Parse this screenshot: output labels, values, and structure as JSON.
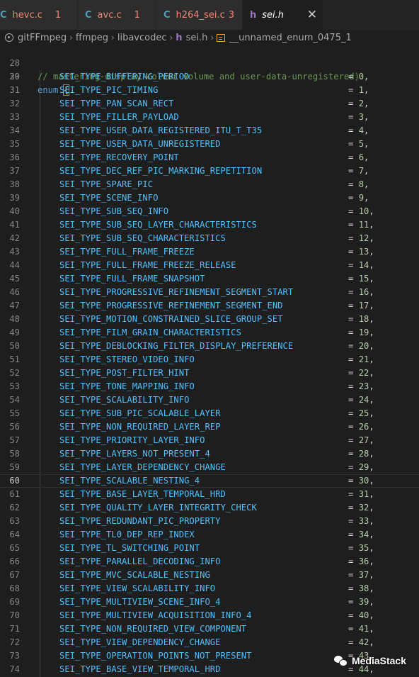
{
  "tabs": [
    {
      "icon": "C",
      "icon_color": "#519aba",
      "name": "hevc.c",
      "name_color": "#f48771",
      "badge": "1",
      "badge_color": "#f48771",
      "active": false
    },
    {
      "icon": "C",
      "icon_color": "#519aba",
      "name": "avc.c",
      "name_color": "#f48771",
      "badge": "1",
      "badge_color": "#f48771",
      "active": false
    },
    {
      "icon": "C",
      "icon_color": "#519aba",
      "name": "h264_sei.c",
      "name_color": "#f48771",
      "badge": "3",
      "badge_color": "#f48771",
      "active": false
    },
    {
      "icon": "h",
      "icon_color": "#a074c4",
      "name": "sei.h",
      "name_color": "#ffffff",
      "badge": "",
      "badge_color": "",
      "active": true,
      "close": "✕"
    }
  ],
  "breadcrumb": {
    "items": [
      "gitFFmpeg",
      "ffmpeg",
      "libavcodec",
      "sei.h",
      "__unnamed_enum_0475_1"
    ],
    "separator": "›"
  },
  "editor": {
    "current_line": 60,
    "comment_line": {
      "number": 28,
      "text": "// mastering-display-colour-volume and user-data-unregistered)."
    },
    "enum_line": {
      "number": 29,
      "keyword": "enum",
      "brace": "{"
    },
    "entries": [
      {
        "line": 30,
        "name": "SEI_TYPE_BUFFERING_PERIOD",
        "value": "0"
      },
      {
        "line": 31,
        "name": "SEI_TYPE_PIC_TIMING",
        "value": "1"
      },
      {
        "line": 32,
        "name": "SEI_TYPE_PAN_SCAN_RECT",
        "value": "2"
      },
      {
        "line": 33,
        "name": "SEI_TYPE_FILLER_PAYLOAD",
        "value": "3"
      },
      {
        "line": 34,
        "name": "SEI_TYPE_USER_DATA_REGISTERED_ITU_T_T35",
        "value": "4"
      },
      {
        "line": 35,
        "name": "SEI_TYPE_USER_DATA_UNREGISTERED",
        "value": "5"
      },
      {
        "line": 36,
        "name": "SEI_TYPE_RECOVERY_POINT",
        "value": "6"
      },
      {
        "line": 37,
        "name": "SEI_TYPE_DEC_REF_PIC_MARKING_REPETITION",
        "value": "7"
      },
      {
        "line": 38,
        "name": "SEI_TYPE_SPARE_PIC",
        "value": "8"
      },
      {
        "line": 39,
        "name": "SEI_TYPE_SCENE_INFO",
        "value": "9"
      },
      {
        "line": 40,
        "name": "SEI_TYPE_SUB_SEQ_INFO",
        "value": "10"
      },
      {
        "line": 41,
        "name": "SEI_TYPE_SUB_SEQ_LAYER_CHARACTERISTICS",
        "value": "11"
      },
      {
        "line": 42,
        "name": "SEI_TYPE_SUB_SEQ_CHARACTERISTICS",
        "value": "12"
      },
      {
        "line": 43,
        "name": "SEI_TYPE_FULL_FRAME_FREEZE",
        "value": "13"
      },
      {
        "line": 44,
        "name": "SEI_TYPE_FULL_FRAME_FREEZE_RELEASE",
        "value": "14"
      },
      {
        "line": 45,
        "name": "SEI_TYPE_FULL_FRAME_SNAPSHOT",
        "value": "15"
      },
      {
        "line": 46,
        "name": "SEI_TYPE_PROGRESSIVE_REFINEMENT_SEGMENT_START",
        "value": "16"
      },
      {
        "line": 47,
        "name": "SEI_TYPE_PROGRESSIVE_REFINEMENT_SEGMENT_END",
        "value": "17"
      },
      {
        "line": 48,
        "name": "SEI_TYPE_MOTION_CONSTRAINED_SLICE_GROUP_SET",
        "value": "18"
      },
      {
        "line": 49,
        "name": "SEI_TYPE_FILM_GRAIN_CHARACTERISTICS",
        "value": "19"
      },
      {
        "line": 50,
        "name": "SEI_TYPE_DEBLOCKING_FILTER_DISPLAY_PREFERENCE",
        "value": "20"
      },
      {
        "line": 51,
        "name": "SEI_TYPE_STEREO_VIDEO_INFO",
        "value": "21"
      },
      {
        "line": 52,
        "name": "SEI_TYPE_POST_FILTER_HINT",
        "value": "22"
      },
      {
        "line": 53,
        "name": "SEI_TYPE_TONE_MAPPING_INFO",
        "value": "23"
      },
      {
        "line": 54,
        "name": "SEI_TYPE_SCALABILITY_INFO",
        "value": "24"
      },
      {
        "line": 55,
        "name": "SEI_TYPE_SUB_PIC_SCALABLE_LAYER",
        "value": "25"
      },
      {
        "line": 56,
        "name": "SEI_TYPE_NON_REQUIRED_LAYER_REP",
        "value": "26"
      },
      {
        "line": 57,
        "name": "SEI_TYPE_PRIORITY_LAYER_INFO",
        "value": "27"
      },
      {
        "line": 58,
        "name": "SEI_TYPE_LAYERS_NOT_PRESENT_4",
        "value": "28"
      },
      {
        "line": 59,
        "name": "SEI_TYPE_LAYER_DEPENDENCY_CHANGE",
        "value": "29"
      },
      {
        "line": 60,
        "name": "SEI_TYPE_SCALABLE_NESTING_4",
        "value": "30"
      },
      {
        "line": 61,
        "name": "SEI_TYPE_BASE_LAYER_TEMPORAL_HRD",
        "value": "31"
      },
      {
        "line": 62,
        "name": "SEI_TYPE_QUALITY_LAYER_INTEGRITY_CHECK",
        "value": "32"
      },
      {
        "line": 63,
        "name": "SEI_TYPE_REDUNDANT_PIC_PROPERTY",
        "value": "33"
      },
      {
        "line": 64,
        "name": "SEI_TYPE_TL0_DEP_REP_INDEX",
        "value": "34"
      },
      {
        "line": 65,
        "name": "SEI_TYPE_TL_SWITCHING_POINT",
        "value": "35"
      },
      {
        "line": 66,
        "name": "SEI_TYPE_PARALLEL_DECODING_INFO",
        "value": "36"
      },
      {
        "line": 67,
        "name": "SEI_TYPE_MVC_SCALABLE_NESTING",
        "value": "37"
      },
      {
        "line": 68,
        "name": "SEI_TYPE_VIEW_SCALABILITY_INFO",
        "value": "38"
      },
      {
        "line": 69,
        "name": "SEI_TYPE_MULTIVIEW_SCENE_INFO_4",
        "value": "39"
      },
      {
        "line": 70,
        "name": "SEI_TYPE_MULTIVIEW_ACQUISITION_INFO_4",
        "value": "40"
      },
      {
        "line": 71,
        "name": "SEI_TYPE_NON_REQUIRED_VIEW_COMPONENT",
        "value": "41"
      },
      {
        "line": 72,
        "name": "SEI_TYPE_VIEW_DEPENDENCY_CHANGE",
        "value": "42"
      },
      {
        "line": 73,
        "name": "SEI_TYPE_OPERATION_POINTS_NOT_PRESENT",
        "value": "43"
      },
      {
        "line": 74,
        "name": "SEI_TYPE_BASE_VIEW_TEMPORAL_HRD",
        "value": "44"
      }
    ]
  },
  "watermark": {
    "text": "MediaStack",
    "icon": "wechat-icon"
  }
}
